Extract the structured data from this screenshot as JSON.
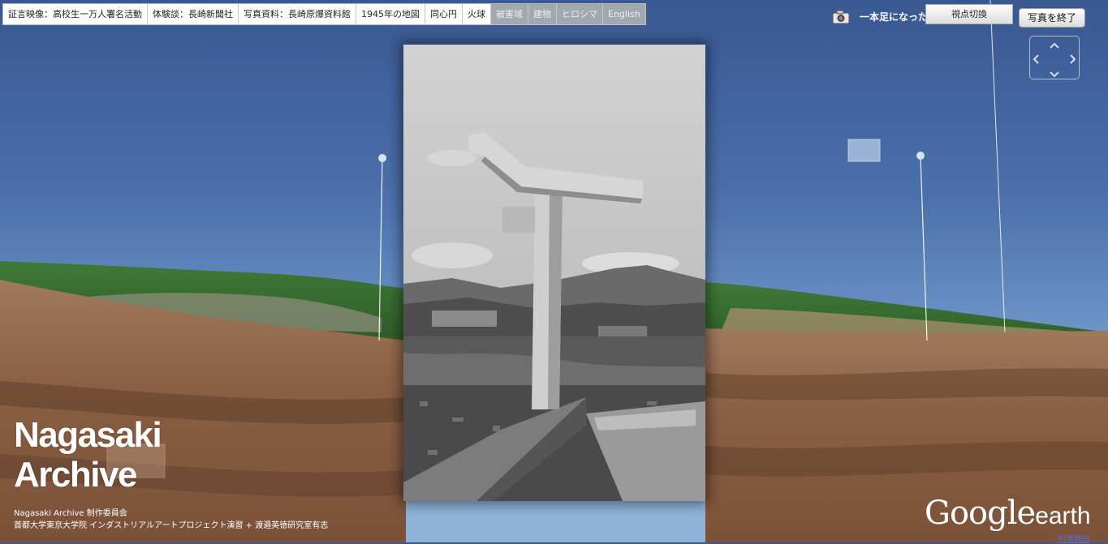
{
  "toolbar": {
    "items": [
      {
        "label": "証言映像：高校生一万人署名活動",
        "enabled": true
      },
      {
        "label": "体験談：長崎新聞社",
        "enabled": true
      },
      {
        "label": "写真資料：長崎原爆資料館",
        "enabled": true
      },
      {
        "label": "1945年の地図",
        "enabled": true
      },
      {
        "label": "同心円",
        "enabled": true
      },
      {
        "label": "火球",
        "enabled": true
      },
      {
        "label": "被害域",
        "enabled": false
      },
      {
        "label": "建物",
        "enabled": false
      },
      {
        "label": "ヒロシマ",
        "enabled": false
      },
      {
        "label": "English",
        "enabled": false
      }
    ]
  },
  "controls": {
    "camera_icon": "camera-icon",
    "caption": "一本足になった鳥居",
    "view_toggle_label": "視点切換",
    "exit_photo_label": "写真を終了",
    "nav_icons": [
      "chevron-up-icon",
      "chevron-left-icon",
      "chevron-right-icon",
      "chevron-down-icon"
    ]
  },
  "logo": {
    "line1": "Nagasaki",
    "line2": "Archive",
    "credit1": "Nagasaki Archive 制作委員会",
    "credit2": "首都大学東京大学院 インダストリアルアートプロジェクト演習 + 渡邉英徳研究室有志"
  },
  "google_earth": {
    "google": "Google",
    "earth": "earth",
    "terms": "利用規約"
  },
  "colors": {
    "sky_top": "#3a5893",
    "sky_bottom": "#7fa5cf",
    "ground": "#8a6246",
    "disabled_item_bg": "#a2a8b0"
  }
}
